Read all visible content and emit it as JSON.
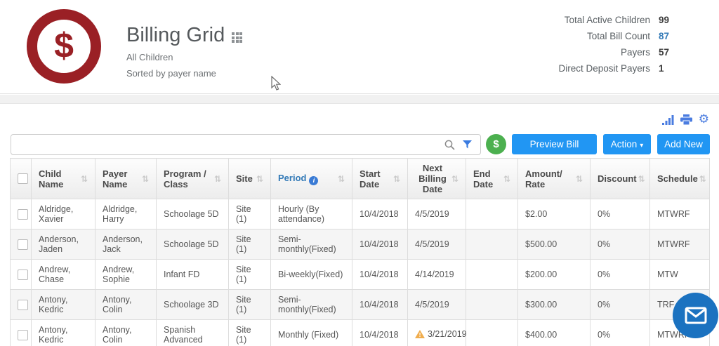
{
  "header": {
    "title": "Billing Grid",
    "subtitle1": "All Children",
    "subtitle2": "Sorted by payer name",
    "stats": [
      {
        "label": "Total Active Children",
        "value": "99"
      },
      {
        "label": "Total Bill Count",
        "value": "87"
      },
      {
        "label": "Payers",
        "value": "57"
      },
      {
        "label": "Direct Deposit Payers",
        "value": "1"
      }
    ]
  },
  "toolbar": {
    "search_value": "",
    "dollar_button_label": "$",
    "preview_bill_label": "Preview Bill",
    "action_label": "Action",
    "add_new_label": "Add New"
  },
  "icons": {
    "gear": "⚙",
    "sort": "⇅",
    "caret_down": "▾",
    "info": "i",
    "logo_dollar": "$",
    "warning": "!"
  },
  "table": {
    "columns": [
      "Child Name",
      "Payer Name",
      "Program / Class",
      "Site",
      "Period",
      "Start Date",
      "Next Billing Date",
      "End Date",
      "Amount/ Rate",
      "Discount",
      "Schedule"
    ],
    "rows": [
      {
        "child_name": "Aldridge, Xavier",
        "payer_name": "Aldridge, Harry",
        "program_class": "Schoolage 5D",
        "site": "Site (1)",
        "period": "Hourly (By attendance)",
        "start_date": "10/4/2018",
        "next_billing_date": "4/5/2019",
        "end_date": "",
        "amount_rate": "$2.00",
        "discount": "0%",
        "schedule": "MTWRF"
      },
      {
        "child_name": "Anderson, Jaden",
        "payer_name": "Anderson, Jack",
        "program_class": "Schoolage 5D",
        "site": "Site (1)",
        "period": "Semi-monthly(Fixed)",
        "start_date": "10/4/2018",
        "next_billing_date": "4/5/2019",
        "end_date": "",
        "amount_rate": "$500.00",
        "discount": "0%",
        "schedule": "MTWRF"
      },
      {
        "child_name": "Andrew, Chase",
        "payer_name": "Andrew, Sophie",
        "program_class": "Infant FD",
        "site": "Site (1)",
        "period": "Bi-weekly(Fixed)",
        "start_date": "10/4/2018",
        "next_billing_date": "4/14/2019",
        "end_date": "",
        "amount_rate": "$200.00",
        "discount": "0%",
        "schedule": "MTW"
      },
      {
        "child_name": "Antony, Kedric",
        "payer_name": "Antony, Colin",
        "program_class": "Schoolage 3D",
        "site": "Site (1)",
        "period": "Semi-monthly(Fixed)",
        "start_date": "10/4/2018",
        "next_billing_date": "4/5/2019",
        "end_date": "",
        "amount_rate": "$300.00",
        "discount": "0%",
        "schedule": "TRF"
      },
      {
        "child_name": "Antony, Kedric",
        "payer_name": "Antony, Colin",
        "program_class": "Spanish Advanced",
        "site": "Site (1)",
        "period": "Monthly (Fixed)",
        "start_date": "10/4/2018",
        "next_billing_date": "3/21/2019",
        "end_date": "",
        "amount_rate": "$400.00",
        "discount": "0%",
        "schedule": "MTWRF",
        "next_billing_warning": true
      }
    ]
  },
  "colors": {
    "brand_red": "#9a2025",
    "accent_blue": "#2196f3",
    "icon_blue": "#4a7ce0",
    "link_blue": "#337ab7",
    "green": "#4cb04f",
    "warning_orange": "#f0ad4e",
    "chat_blue": "#1b72c0"
  }
}
